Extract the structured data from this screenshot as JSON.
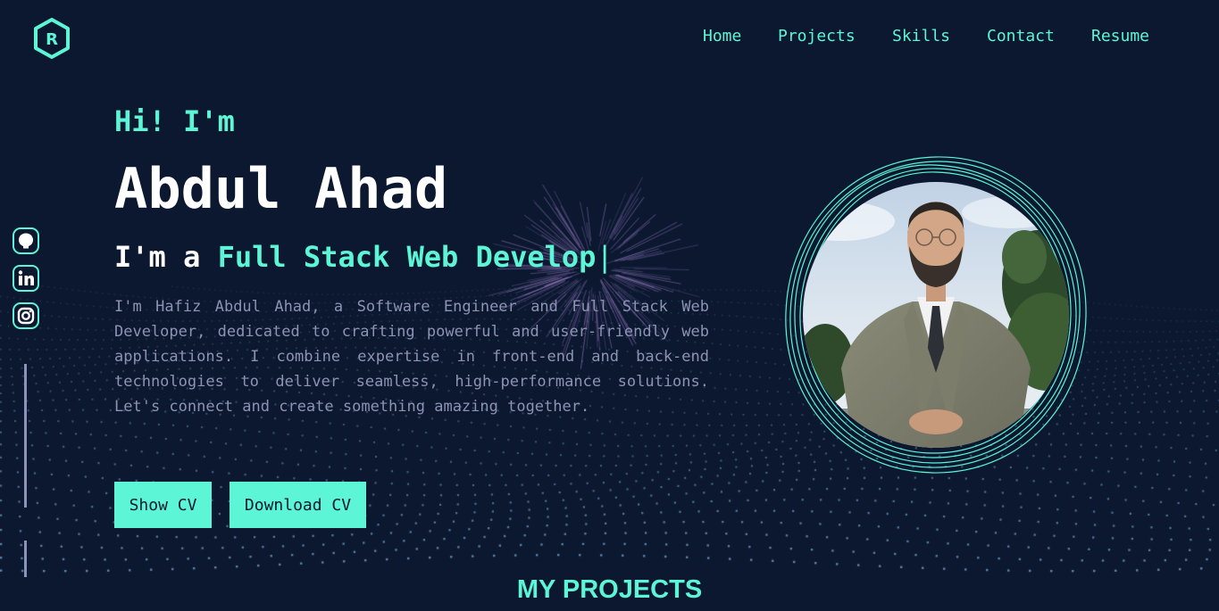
{
  "brand": {
    "logo_letter": "R"
  },
  "nav": {
    "items": [
      {
        "label": "Home"
      },
      {
        "label": "Projects"
      },
      {
        "label": "Skills"
      },
      {
        "label": "Contact"
      },
      {
        "label": "Resume"
      }
    ]
  },
  "social": {
    "icons": [
      "github-icon",
      "linkedin-icon",
      "instagram-icon"
    ]
  },
  "hero": {
    "greeting": "Hi! I'm",
    "name": "Abdul Ahad",
    "role_prefix": "I'm a",
    "role_typed": "Full Stack Web Develop",
    "cursor": "|",
    "bio": "I'm Hafiz Abdul Ahad, a Software Engineer and Full Stack Web Developer, dedicated to crafting powerful and user-friendly web applications. I combine expertise in front-end and back-end technologies to deliver seamless, high-performance solutions. Let's connect and create something amazing together.",
    "buttons": {
      "show_cv": "Show CV",
      "download_cv": "Download CV"
    }
  },
  "sections": {
    "projects_title": "MY PROJECTS"
  },
  "colors": {
    "accent": "#5cf5d5",
    "background": "#0b1830",
    "body_text": "#8d93b3",
    "heading": "#ffffff"
  }
}
